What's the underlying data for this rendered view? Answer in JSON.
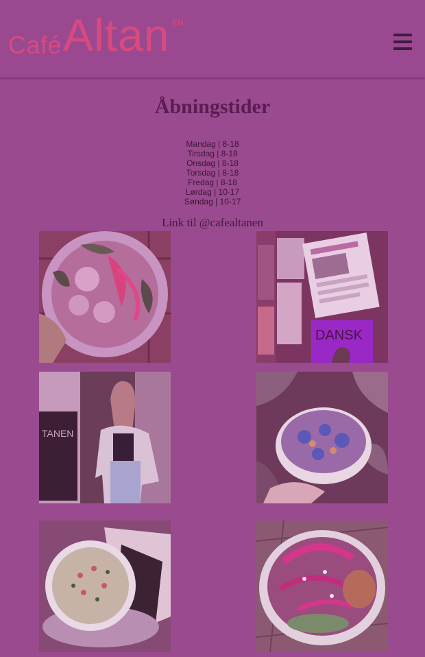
{
  "header": {
    "logo_cafe": "Café",
    "logo_altan": "Altan",
    "lang_link": "EN"
  },
  "main": {
    "title": "Åbningstider",
    "hours": [
      "Mandag | 8-18",
      "Tirsdag | 8-18",
      "Onsdag | 8-18",
      "Torsdag | 8-18",
      "Fredag | 8-18",
      "Lørdag | 10-17",
      "Søndag | 10-17"
    ],
    "instagram_link": "Link til @cafealtanen",
    "gallery": [
      {
        "subject": "salad-bowl-photo"
      },
      {
        "subject": "newspapers-photo",
        "caption": "DANSK"
      },
      {
        "subject": "woman-portrait-photo",
        "sign_text": "TANEN"
      },
      {
        "subject": "flower-bowl-photo"
      },
      {
        "subject": "soup-bowl-photo"
      },
      {
        "subject": "beet-salad-photo"
      }
    ]
  },
  "colors": {
    "overlay": "#9a4a8e",
    "logo": "#d84a7f",
    "title": "#5a1d52",
    "text": "#3b1737"
  }
}
